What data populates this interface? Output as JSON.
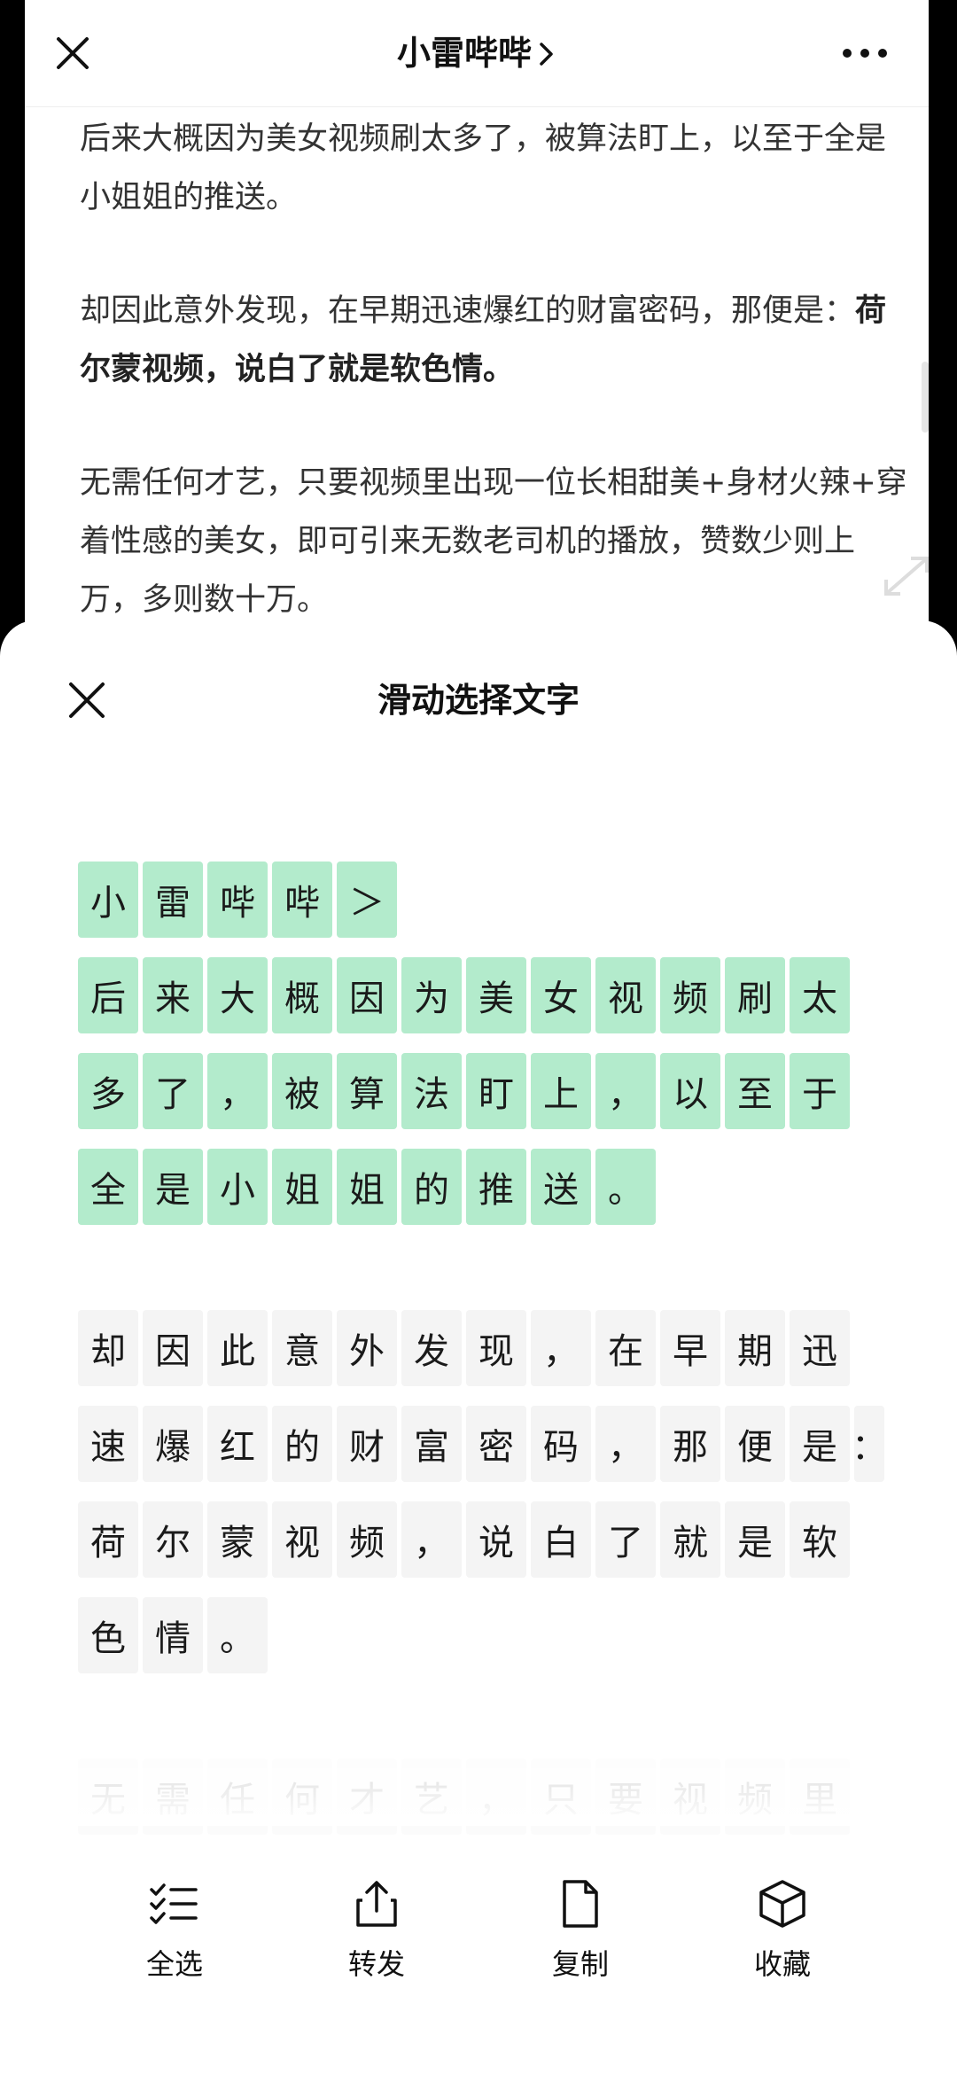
{
  "article": {
    "title": "小雷哔哔",
    "para1": "后来大概因为美女视频刷太多了，被算法盯上，以至于全是小姐姐的推送。",
    "para2_plain": "却因此意外发现，在早期迅速爆红的财富密码，那便是：",
    "para2_bold": "荷尔蒙视频，说白了就是软色情。",
    "para3": "无需任何才艺，只要视频里出现一位长相甜美+身材火辣+穿着性感的美女，即可引来无数老司机的播放，赞数少则上万，多则数十万。"
  },
  "sheet": {
    "title": "滑动选择文字",
    "rows": [
      {
        "selected": true,
        "chars": [
          "小",
          "雷",
          "哔",
          "哔",
          "＞"
        ]
      },
      {
        "selected": true,
        "chars": [
          "后",
          "来",
          "大",
          "概",
          "因",
          "为",
          "美",
          "女",
          "视",
          "频",
          "刷",
          "太"
        ]
      },
      {
        "selected": true,
        "chars": [
          "多",
          "了",
          "，",
          "被",
          "算",
          "法",
          "盯",
          "上",
          "，",
          "以",
          "至",
          "于"
        ]
      },
      {
        "selected": true,
        "chars": [
          "全",
          "是",
          "小",
          "姐",
          "姐",
          "的",
          "推",
          "送",
          "。"
        ]
      },
      {
        "selected": false,
        "chars": [
          "却",
          "因",
          "此",
          "意",
          "外",
          "发",
          "现",
          "，",
          "在",
          "早",
          "期",
          "迅"
        ]
      },
      {
        "selected": false,
        "chars": [
          "速",
          "爆",
          "红",
          "的",
          "财",
          "富",
          "密",
          "码",
          "，",
          "那",
          "便",
          "是",
          "："
        ]
      },
      {
        "selected": false,
        "chars": [
          "荷",
          "尔",
          "蒙",
          "视",
          "频",
          "，",
          "说",
          "白",
          "了",
          "就",
          "是",
          "软"
        ]
      },
      {
        "selected": false,
        "chars": [
          "色",
          "情",
          "。"
        ]
      },
      {
        "selected": false,
        "chars": [
          "无",
          "需",
          "任",
          "何",
          "才",
          "艺",
          "，",
          "只",
          "要",
          "视",
          "频",
          "里"
        ]
      }
    ]
  },
  "toolbar": {
    "select_all": "全选",
    "forward": "转发",
    "copy": "复制",
    "favorite": "收藏"
  },
  "icons": {
    "close": "close-icon",
    "more": "more-icon",
    "select_all": "checklist-icon",
    "forward": "share-icon",
    "copy": "document-icon",
    "favorite": "cube-icon"
  },
  "colors": {
    "selection": "#b3ebcc",
    "unselected_cell": "#f4f4f4"
  }
}
